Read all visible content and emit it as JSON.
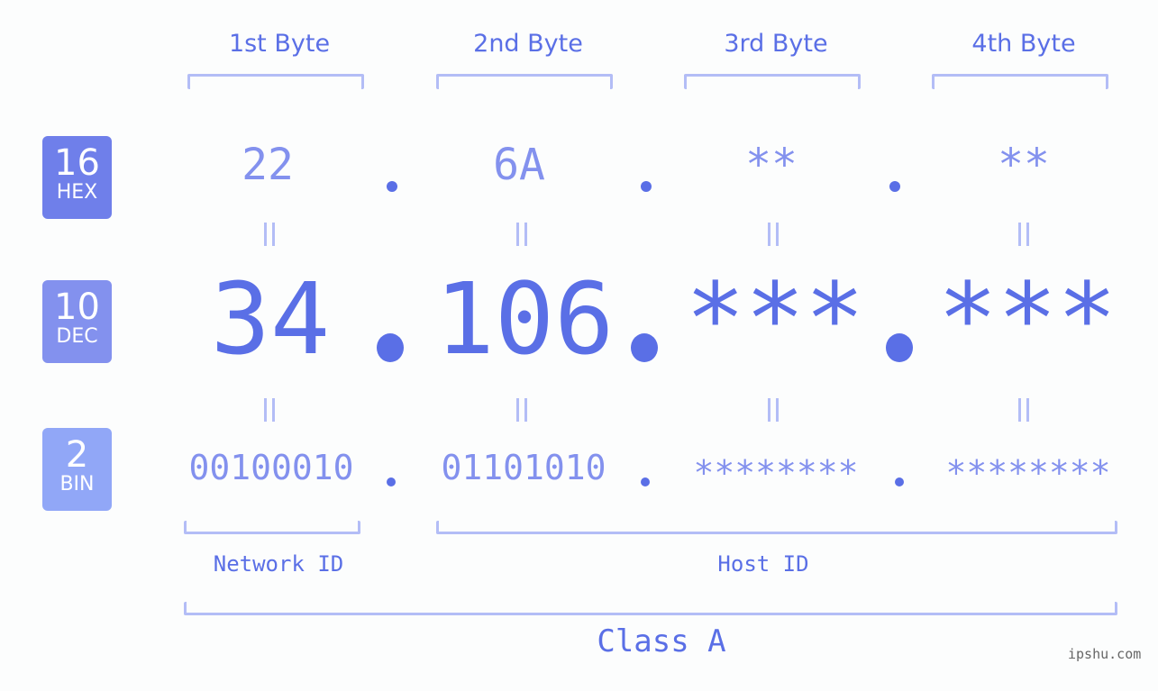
{
  "bytes": [
    {
      "label": "1st Byte",
      "hex": "22",
      "dec": "34",
      "bin": "00100010"
    },
    {
      "label": "2nd Byte",
      "hex": "6A",
      "dec": "106",
      "bin": "01101010"
    },
    {
      "label": "3rd Byte",
      "hex": "**",
      "dec": "***",
      "bin": "********"
    },
    {
      "label": "4th Byte",
      "hex": "**",
      "dec": "***",
      "bin": "********"
    }
  ],
  "badges": {
    "hex": {
      "num": "16",
      "label": "HEX",
      "color": "#6f7fea"
    },
    "dec": {
      "num": "10",
      "label": "DEC",
      "color": "#8391ee"
    },
    "bin": {
      "num": "2",
      "label": "BIN",
      "color": "#91a7f7"
    }
  },
  "segments": {
    "network": "Network ID",
    "host": "Host ID",
    "class": "Class A"
  },
  "watermark": "ipshu.com",
  "colors": {
    "accent": "#5a6fe6",
    "light": "#8391ee",
    "bracket": "#b3bdf6"
  }
}
